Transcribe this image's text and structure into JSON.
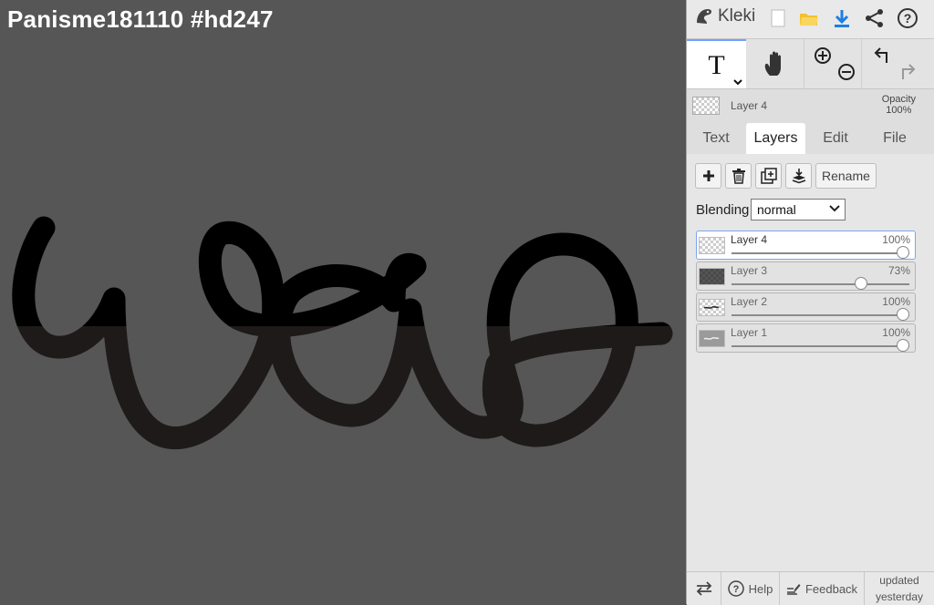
{
  "canvas": {
    "document_title": "Panisme181110 #hd247",
    "background_color": "#565656",
    "ink_colors": [
      "#000000",
      "#1f1a1a"
    ]
  },
  "app": {
    "brand_label": "Kleki"
  },
  "toolbar_top": {
    "icons": [
      "new-image-icon",
      "open-folder-icon",
      "download-icon",
      "share-icon",
      "help-icon"
    ]
  },
  "tools": {
    "text_tool_label": "T",
    "icons": [
      "text-tool-icon",
      "hand-tool-icon",
      "zoom-in-icon",
      "zoom-out-icon",
      "undo-icon",
      "redo-icon"
    ]
  },
  "active_layer": {
    "name": "Layer 4",
    "opacity_label": "Opacity",
    "opacity_value": "100%"
  },
  "tabs": [
    {
      "label": "Text",
      "active": false
    },
    {
      "label": "Layers",
      "active": true
    },
    {
      "label": "Edit",
      "active": false
    },
    {
      "label": "File",
      "active": false
    }
  ],
  "layers_panel": {
    "buttons": [
      "add-layer-icon",
      "delete-layer-icon",
      "duplicate-layer-icon",
      "merge-down-icon"
    ],
    "rename_label": "Rename",
    "blending_label": "Blending",
    "blending_value": "normal",
    "layers": [
      {
        "name": "Layer 4",
        "opacity": "100%",
        "opacity_fraction": 1.0,
        "selected": true
      },
      {
        "name": "Layer 3",
        "opacity": "73%",
        "opacity_fraction": 0.73,
        "selected": false
      },
      {
        "name": "Layer 2",
        "opacity": "100%",
        "opacity_fraction": 1.0,
        "selected": false
      },
      {
        "name": "Layer 1",
        "opacity": "100%",
        "opacity_fraction": 1.0,
        "selected": false
      }
    ]
  },
  "footer": {
    "swap_icon": "swap-arrows-icon",
    "help_label": "Help",
    "feedback_label": "Feedback",
    "updated_line1": "updated",
    "updated_line2": "yesterday"
  }
}
